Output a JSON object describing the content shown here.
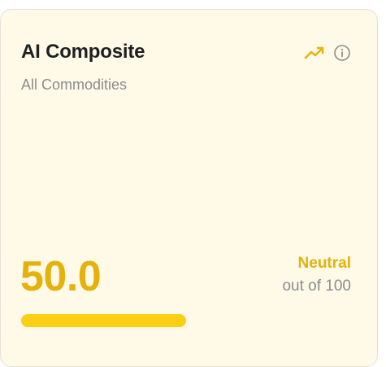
{
  "card": {
    "title": "AI Composite",
    "subtitle": "All Commodities",
    "value": "50.0",
    "status": "Neutral",
    "scale_text": "out of 100",
    "progress": 0.5
  },
  "icons": {
    "trend": "trending-up-icon",
    "info": "info-icon"
  },
  "colors": {
    "card_background": "#fffae7",
    "accent": "#e5b10b",
    "progress": "#fbd014",
    "muted_text": "#8b8c90"
  }
}
